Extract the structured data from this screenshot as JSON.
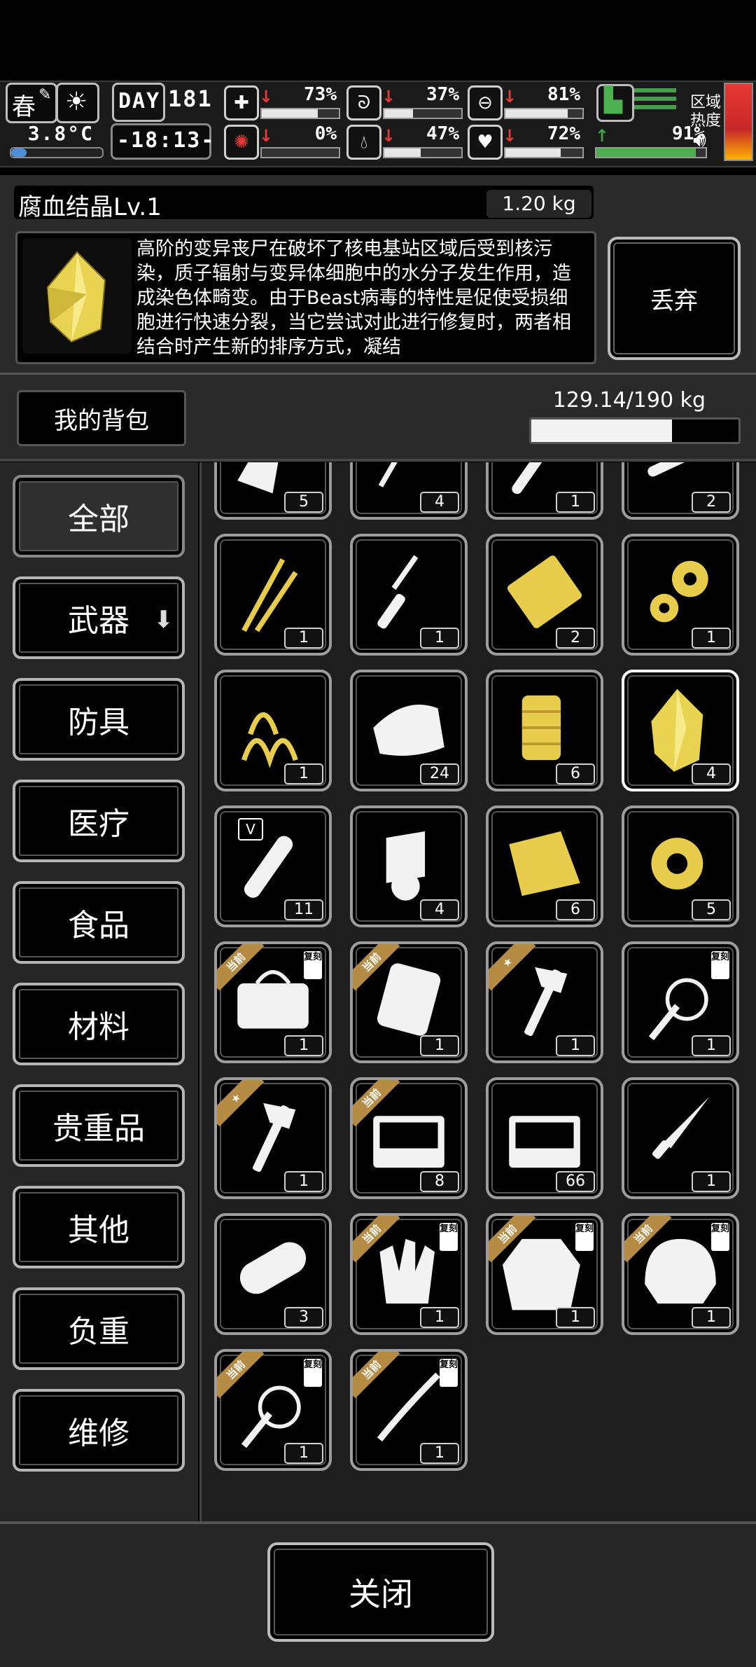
{
  "status": {
    "season": "春",
    "temperature": "3.8°C",
    "day_label": "DAY",
    "day": "181",
    "time": "-18:13-",
    "region_label_1": "区域",
    "region_label_2": "热度",
    "stats": [
      {
        "name": "health",
        "icon": "medkit-icon",
        "arrow": "↓",
        "arrow_color": "#e53935",
        "value": "73%",
        "level": 0.73,
        "bar_color": "#e6e6e6"
      },
      {
        "name": "hunger",
        "icon": "stomach-icon",
        "arrow": "↓",
        "arrow_color": "#e53935",
        "value": "37%",
        "level": 0.37,
        "bar_color": "#e6e6e6"
      },
      {
        "name": "stamina",
        "icon": "mask-icon",
        "arrow": "↓",
        "arrow_color": "#e53935",
        "value": "81%",
        "level": 0.81,
        "bar_color": "#e6e6e6"
      },
      {
        "name": "infection",
        "icon": "brain-icon",
        "arrow": "↓",
        "arrow_color": "#e53935",
        "value": "0%",
        "level": 0.0,
        "bar_color": "#e6e6e6"
      },
      {
        "name": "thirst",
        "icon": "water-drop-icon",
        "arrow": "↓",
        "arrow_color": "#e53935",
        "value": "47%",
        "level": 0.47,
        "bar_color": "#e6e6e6"
      },
      {
        "name": "mood",
        "icon": "heart-icon",
        "arrow": "↓",
        "arrow_color": "#e53935",
        "value": "72%",
        "level": 0.72,
        "bar_color": "#e6e6e6"
      },
      {
        "name": "energy",
        "icon": "boot-icon",
        "arrow": "↑",
        "arrow_color": "#43a047",
        "value": "91%",
        "level": 0.91,
        "bar_color": "#4caf50"
      }
    ]
  },
  "item": {
    "name": "腐血结晶Lv.1",
    "weight": "1.20 kg",
    "description": "高阶的变异丧尸在破坏了核电基站区域后受到核污染，质子辐射与变异体细胞中的水分子发生作用，造成染色体畸变。由于Beast病毒的特性是促使受损细胞进行快速分裂，当它尝试对此进行修复时，两者相结合时产生新的排序方式，凝结",
    "icon": "crystal-icon",
    "discard_label": "丢弃"
  },
  "bag": {
    "label": "我的背包",
    "weight": "129.14/190 kg",
    "fill": 0.68
  },
  "categories": [
    {
      "label": "全部",
      "active": true
    },
    {
      "label": "武器",
      "download": true
    },
    {
      "label": "防具"
    },
    {
      "label": "医疗"
    },
    {
      "label": "食品"
    },
    {
      "label": "材料"
    },
    {
      "label": "贵重品"
    },
    {
      "label": "其他"
    },
    {
      "label": "负重"
    },
    {
      "label": "维修"
    }
  ],
  "items": [
    {
      "icon": "bottle-icon",
      "count": "5",
      "color": "white"
    },
    {
      "icon": "rolling-pin-icon",
      "count": "4",
      "color": "white"
    },
    {
      "icon": "pipe-icon",
      "count": "1",
      "color": "white"
    },
    {
      "icon": "pipes-icon",
      "count": "2",
      "color": "white"
    },
    {
      "icon": "wires-icon",
      "count": "1",
      "color": "gold"
    },
    {
      "icon": "screwdriver-icon",
      "count": "1",
      "color": "white"
    },
    {
      "icon": "metal-plate-icon",
      "count": "2",
      "color": "gold"
    },
    {
      "icon": "gears-icon",
      "count": "1",
      "color": "gold"
    },
    {
      "icon": "springs-icon",
      "count": "1",
      "color": "gold"
    },
    {
      "icon": "cloth-icon",
      "count": "24",
      "color": "white"
    },
    {
      "icon": "rope-spool-icon",
      "count": "6",
      "color": "gold"
    },
    {
      "icon": "crystal-icon",
      "count": "4",
      "color": "gold",
      "selected": true
    },
    {
      "icon": "test-tube-icon",
      "count": "11",
      "color": "white",
      "badge": "V"
    },
    {
      "icon": "paper-roll-icon",
      "count": "4",
      "color": "white"
    },
    {
      "icon": "gold-cloth-icon",
      "count": "6",
      "color": "gold"
    },
    {
      "icon": "tape-roll-icon",
      "count": "5",
      "color": "gold"
    },
    {
      "icon": "bag-icon",
      "count": "1",
      "color": "white",
      "ribbon": "当前",
      "copy": "复刻"
    },
    {
      "icon": "backpack-icon",
      "count": "1",
      "color": "white",
      "ribbon": "当前"
    },
    {
      "icon": "hatchet-icon",
      "count": "1",
      "color": "white",
      "ribbon": "★"
    },
    {
      "icon": "whip-icon",
      "count": "1",
      "color": "white",
      "copy": "复刻"
    },
    {
      "icon": "hatchet-icon",
      "count": "1",
      "color": "white",
      "ribbon": "★"
    },
    {
      "icon": "crate-icon",
      "count": "8",
      "color": "white",
      "ribbon": "当前"
    },
    {
      "icon": "crate-icon",
      "count": "66",
      "color": "white"
    },
    {
      "icon": "knife-icon",
      "count": "1",
      "color": "white"
    },
    {
      "icon": "log-icon",
      "count": "3",
      "color": "white"
    },
    {
      "icon": "gloves-icon",
      "count": "1",
      "color": "white",
      "ribbon": "当前",
      "copy": "复刻"
    },
    {
      "icon": "coat-icon",
      "count": "1",
      "color": "white",
      "ribbon": "当前",
      "copy": "复刻"
    },
    {
      "icon": "helmet-icon",
      "count": "1",
      "color": "white",
      "ribbon": "当前",
      "copy": "复刻"
    },
    {
      "icon": "whip-icon",
      "count": "1",
      "color": "white",
      "ribbon": "当前",
      "copy": "复刻"
    },
    {
      "icon": "chain-icon",
      "count": "1",
      "color": "white",
      "ribbon": "当前",
      "copy": "复刻"
    }
  ],
  "close_label": "关闭"
}
